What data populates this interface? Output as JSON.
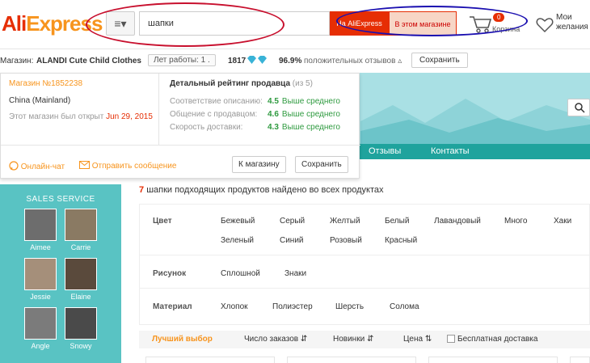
{
  "header": {
    "logo_main": "Ali",
    "logo_sub": "Express",
    "category_btn": "≡▾",
    "search_value": "шапки",
    "btn_aliexpress": "На AliExpress",
    "btn_store": "В этом магазине",
    "cart_count": "0",
    "cart_label": "Корзина",
    "wish_line1": "Мои",
    "wish_line2": "желания"
  },
  "storebar": {
    "store_label": "Магазин:",
    "store_name": "ALANDI Cute Child Clothes",
    "years": "Лет работы: 1 .",
    "score": "1817",
    "positive": "96.9%",
    "positive_text": "положительных отзывов ▵",
    "save": "Сохранить"
  },
  "popup": {
    "store_no": "Магазин №1852238",
    "country": "China (Mainland)",
    "opened_text": "Этот магазин был открыт",
    "opened_date": "Jun 29, 2015",
    "rating_title": "Детальный рейтинг продавца",
    "rating_of": "(из 5)",
    "ratings": [
      {
        "label": "Соответствие описанию:",
        "value": "4.5",
        "text": "Выше среднего"
      },
      {
        "label": "Общение с продавцом:",
        "value": "4.6",
        "text": "Выше среднего"
      },
      {
        "label": "Скорость доставки:",
        "value": "4.3",
        "text": "Выше среднего"
      }
    ],
    "chat": "Онлайн-чат",
    "message": "Отправить сообщение",
    "to_store": "К магазину",
    "save": "Сохранить"
  },
  "nav": {
    "reviews": "Отзывы",
    "contacts": "Контакты"
  },
  "sales": {
    "title": "SALES SERVICE",
    "agents": [
      "Aimee",
      "Carrie",
      "Jessie",
      "Elaine",
      "Angle",
      "Snowy"
    ]
  },
  "results": {
    "count": "7",
    "text": "шапки подходящих продуктов найдено во всех продуктах"
  },
  "filters": {
    "color_label": "Цвет",
    "colors": [
      "Бежевый",
      "Серый",
      "Желтый",
      "Белый",
      "Лавандовый",
      "Много",
      "Хаки",
      "Зеленый",
      "Синий",
      "Розовый",
      "Красный"
    ],
    "pattern_label": "Рисунок",
    "patterns": [
      "Сплошной",
      "Знаки"
    ],
    "material_label": "Материал",
    "materials": [
      "Хлопок",
      "Полиэстер",
      "Шерсть",
      "Солома"
    ]
  },
  "sort": {
    "best": "Лучший выбор",
    "orders": "Число заказов ⇵",
    "new": "Новинки ⇵",
    "price": "Цена ⇅",
    "free_ship": "Бесплатная доставка"
  }
}
